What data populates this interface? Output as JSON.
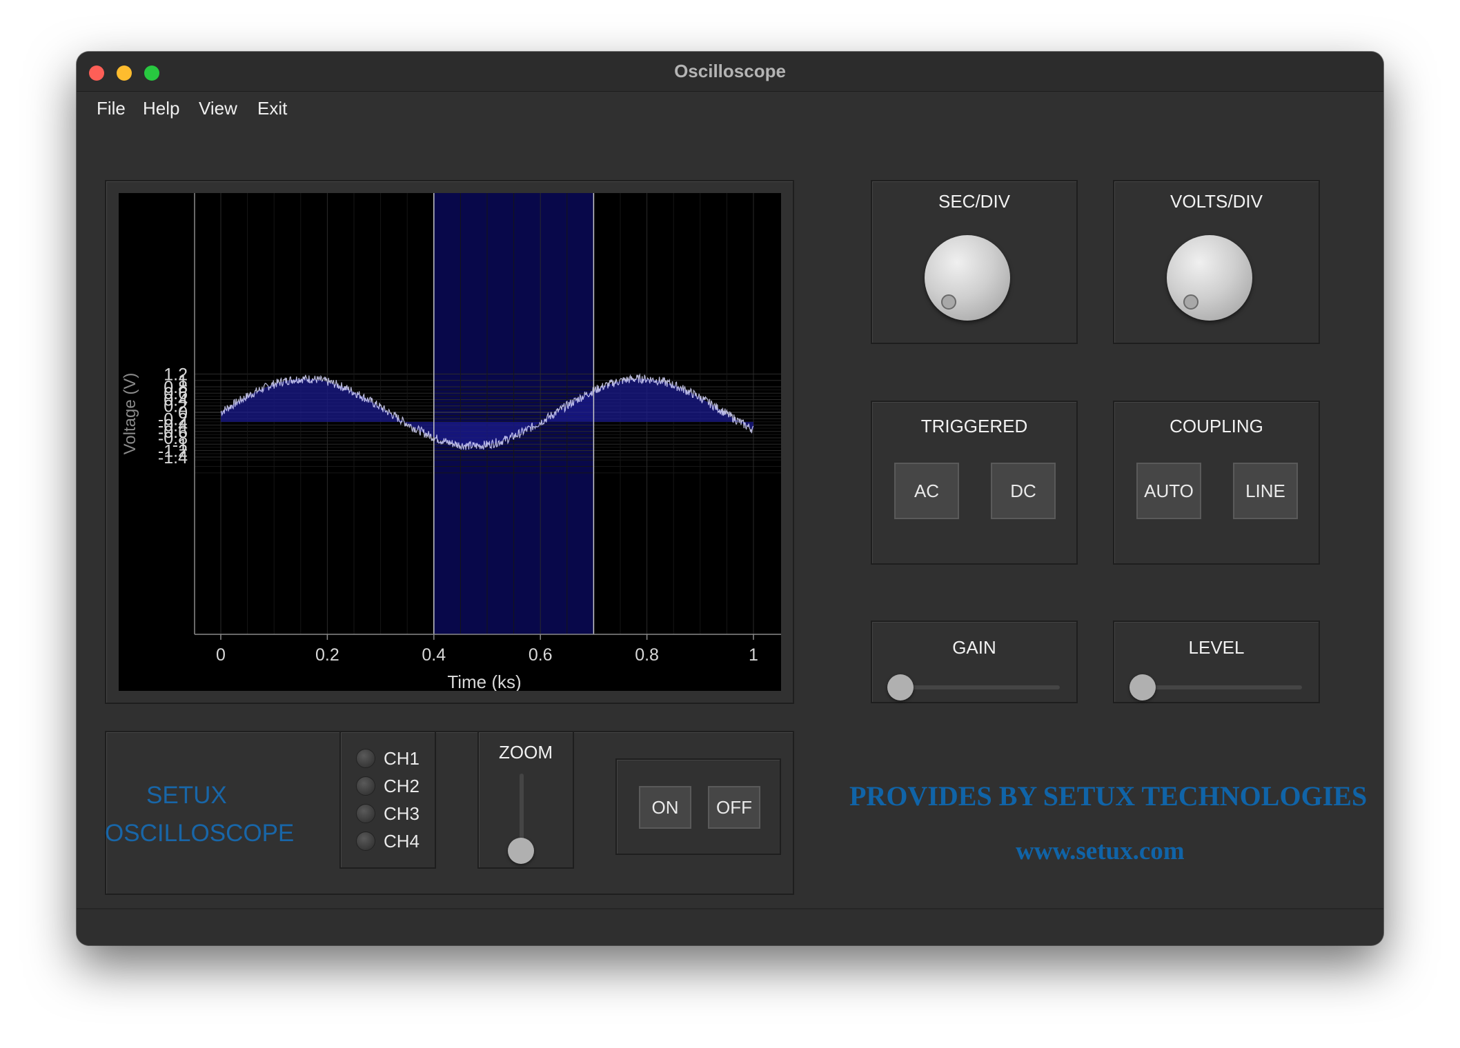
{
  "window": {
    "title": "Oscilloscope"
  },
  "menu": [
    "File",
    "Help",
    "View",
    "Exit"
  ],
  "chart_data": {
    "type": "area",
    "xlabel": "Time (ks)",
    "ylabel": "Voltage (V)",
    "x_ticks": [
      "0",
      "0.2",
      "0.4",
      "0.6",
      "0.8",
      "1"
    ],
    "y_ticks": [
      "1.2",
      "1",
      "0.8",
      "0.6",
      "0.4",
      "0.2",
      "0",
      "-0.2",
      "-0.4",
      "-0.6",
      "-0.8",
      "-1",
      "-1.2",
      "-1.4"
    ],
    "xlim": [
      0,
      1
    ],
    "ylim": [
      -1.4,
      1.35
    ],
    "baseline": -0.3,
    "highlight_range": [
      0.4,
      0.7
    ],
    "signal": "noisy sine, amplitude 1.05, period 0.63",
    "series": [
      {
        "x": [
          0,
          0.05,
          0.1,
          0.15,
          0.2,
          0.25,
          0.3,
          0.35,
          0.4,
          0.45,
          0.5,
          0.55,
          0.6,
          0.65,
          0.7,
          0.75,
          0.8,
          0.85,
          0.9,
          0.95,
          1
        ],
        "values": [
          0,
          0.5,
          0.88,
          1.05,
          0.95,
          0.6,
          0.12,
          -0.38,
          -0.82,
          -1.05,
          -1.0,
          -0.72,
          -0.25,
          0.3,
          0.78,
          1.02,
          1.03,
          0.8,
          0.38,
          -0.12,
          -0.55
        ]
      }
    ],
    "grid": true,
    "colors": {
      "fill": "#1a1a8c",
      "highlight": "#08084a",
      "line": "#d8d8ff"
    }
  },
  "knobs": {
    "sec_div": "SEC/DIV",
    "volts_div": "VOLTS/DIV"
  },
  "triggered": {
    "title": "TRIGGERED",
    "ac": "AC",
    "dc": "DC"
  },
  "coupling": {
    "title": "COUPLING",
    "auto": "AUTO",
    "line": "LINE"
  },
  "gain": {
    "title": "GAIN",
    "value": 0
  },
  "level": {
    "title": "LEVEL",
    "value": 0
  },
  "brand": {
    "line1": "SETUX",
    "line2": "OSCILLOSCOPE"
  },
  "channels": [
    "CH1",
    "CH2",
    "CH3",
    "CH4"
  ],
  "zoom": {
    "title": "ZOOM",
    "value": 0
  },
  "power": {
    "on": "ON",
    "off": "OFF"
  },
  "footer": {
    "provides": "PROVIDES BY SETUX TECHNOLOGIES",
    "url": "www.setux.com"
  },
  "colors": {
    "accent": "#1866a8",
    "window": "#303030"
  }
}
